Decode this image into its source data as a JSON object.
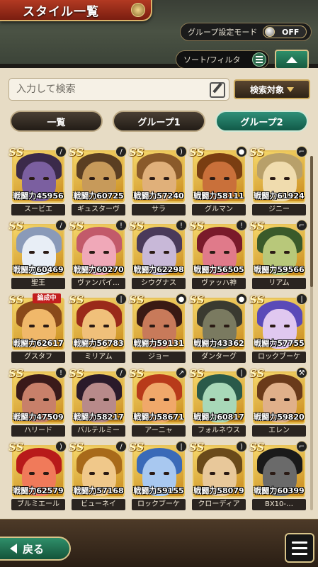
{
  "header": {
    "title": "スタイル一覧"
  },
  "group_mode": {
    "label": "グループ設定モード",
    "state": "OFF"
  },
  "sort_filter": {
    "label": "ソート/フィルタ"
  },
  "search": {
    "placeholder": "入力して検索",
    "target_label": "検索対象"
  },
  "tabs": [
    {
      "label": "一覧",
      "active": false
    },
    {
      "label": "グループ1",
      "active": false
    },
    {
      "label": "グループ2",
      "active": true
    }
  ],
  "power_prefix": "戦闘力",
  "rank_label": "SS",
  "formation_badge": "編成中",
  "characters": [
    {
      "name": "スービエ",
      "power": "45956",
      "palette": [
        "#3b2a4a",
        "#7b5fa0"
      ],
      "corner": "sword-icon"
    },
    {
      "name": "ギュスターヴ",
      "power": "60725",
      "palette": [
        "#5a3e22",
        "#c79a5a"
      ],
      "corner": "sword-icon"
    },
    {
      "name": "サラ",
      "power": "57240",
      "palette": [
        "#8a5a2a",
        "#e0b07a"
      ],
      "corner": "bow-icon"
    },
    {
      "name": "グルマン",
      "power": "58111",
      "palette": [
        "#7a3e12",
        "#c9703a"
      ],
      "corner": "fist-icon"
    },
    {
      "name": "ジニー",
      "power": "61924",
      "palette": [
        "#b8a06a",
        "#f0dcae"
      ],
      "corner": "gun-icon"
    },
    {
      "name": "聖王",
      "power": "60469",
      "palette": [
        "#8a9ab8",
        "#e8eef6"
      ],
      "corner": "sword-icon"
    },
    {
      "name": "ヴァンパイ…",
      "power": "60270",
      "palette": [
        "#c25a6a",
        "#f0a8b8"
      ],
      "corner": "alert-icon"
    },
    {
      "name": "シウグナス",
      "power": "62298",
      "palette": [
        "#4a3a5a",
        "#c8b8d8"
      ],
      "corner": "alert-icon"
    },
    {
      "name": "ヴァッハ神",
      "power": "56505",
      "palette": [
        "#7a1a2a",
        "#e07a8a"
      ],
      "corner": "alert-icon"
    },
    {
      "name": "リアム",
      "power": "59566",
      "palette": [
        "#3a5a2a",
        "#b8c87a"
      ],
      "corner": "gun-icon"
    },
    {
      "name": "グスタフ",
      "power": "62617",
      "palette": [
        "#8a4a1a",
        "#f0b86a"
      ],
      "corner": "formation"
    },
    {
      "name": "ミリアム",
      "power": "56783",
      "palette": [
        "#9a2a1a",
        "#f0c07a"
      ],
      "corner": "staff-icon"
    },
    {
      "name": "ジョー",
      "power": "59131",
      "palette": [
        "#3a1a14",
        "#c87a5a"
      ],
      "corner": "fist-icon"
    },
    {
      "name": "ダンターグ",
      "power": "43362",
      "palette": [
        "#3a3a30",
        "#7a7a60"
      ],
      "corner": "fist-icon"
    },
    {
      "name": "ロックブーケ",
      "power": "57755",
      "palette": [
        "#5a4ab8",
        "#e0c8f0"
      ],
      "corner": "staff-icon"
    },
    {
      "name": "ハリード",
      "power": "47509",
      "palette": [
        "#3a1a1a",
        "#c8806a"
      ],
      "corner": "alert-icon"
    },
    {
      "name": "バルテルミー",
      "power": "58217",
      "palette": [
        "#2a1a2a",
        "#b88a8a"
      ],
      "corner": "sword-icon"
    },
    {
      "name": "アーニャ",
      "power": "58671",
      "palette": [
        "#b83a1a",
        "#f0a86a"
      ],
      "corner": "spear-icon"
    },
    {
      "name": "フォルネウス",
      "power": "60817",
      "palette": [
        "#2a5a4a",
        "#a8d8b8"
      ],
      "corner": "staff-icon"
    },
    {
      "name": "エレン",
      "power": "59820",
      "palette": [
        "#6a3a1a",
        "#e0b08a"
      ],
      "corner": "axe-icon"
    },
    {
      "name": "ブルミエール",
      "power": "62579",
      "palette": [
        "#b81a1a",
        "#f07a5a"
      ],
      "corner": "bow-icon"
    },
    {
      "name": "ビューネイ",
      "power": "57168",
      "palette": [
        "#a86a1a",
        "#f0c88a"
      ],
      "corner": "sword-icon"
    },
    {
      "name": "ロックブーケ",
      "power": "59155",
      "palette": [
        "#3a6ab8",
        "#a8c8f0"
      ],
      "corner": "staff-icon"
    },
    {
      "name": "クローディア",
      "power": "58079",
      "palette": [
        "#6a4a1a",
        "#e8c89a"
      ],
      "corner": "bow-icon"
    },
    {
      "name": "BX10-…",
      "power": "60399",
      "palette": [
        "#1a1a1a",
        "#6a6a6a"
      ],
      "corner": "gun-icon"
    }
  ],
  "footer": {
    "back_label": "戻る"
  }
}
